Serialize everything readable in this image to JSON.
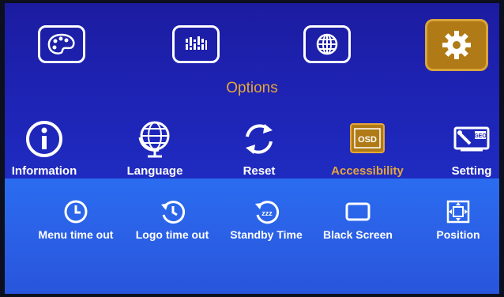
{
  "top_menu": [
    {
      "name": "palette",
      "icon": "palette-icon"
    },
    {
      "name": "equalizer",
      "icon": "equalizer-icon"
    },
    {
      "name": "globe",
      "icon": "globe-icon"
    },
    {
      "name": "settings",
      "icon": "gear-icon",
      "active": true
    }
  ],
  "section_title": "Options",
  "options": [
    {
      "label": "Information",
      "icon": "info-icon"
    },
    {
      "label": "Language",
      "icon": "globe-icon"
    },
    {
      "label": "Reset",
      "icon": "reset-icon"
    },
    {
      "label": "Accessibility",
      "icon": "osd-icon",
      "active": true
    },
    {
      "label": "Setting",
      "icon": "setting-icon"
    }
  ],
  "accessibility": [
    {
      "label": "Menu time out",
      "icon": "clock-icon"
    },
    {
      "label": "Logo time out",
      "icon": "history-icon"
    },
    {
      "label": "Standby Time",
      "icon": "standby-icon"
    },
    {
      "label": "Black Screen",
      "icon": "black-screen-icon"
    },
    {
      "label": "Position",
      "icon": "position-icon"
    }
  ],
  "osd_badge": "OSD",
  "setting_badge": "GEO",
  "standby_badge": "zzz",
  "colors": {
    "active": "#e6a63a",
    "active_bg": "#b07b16",
    "text": "#ffffff"
  }
}
